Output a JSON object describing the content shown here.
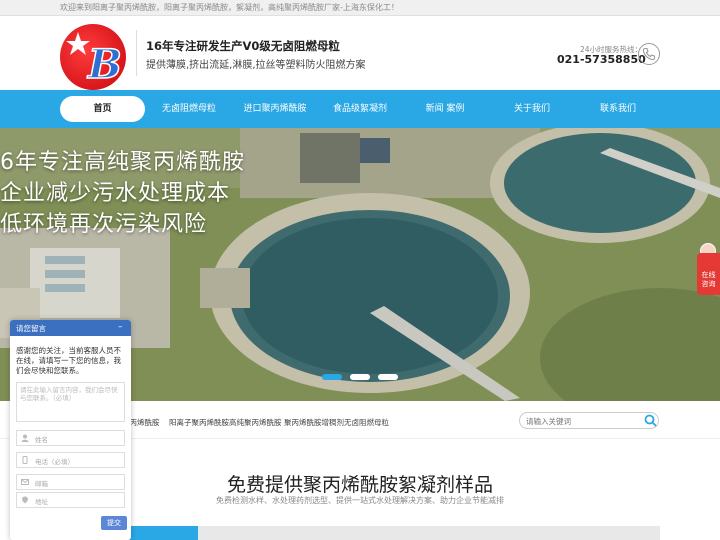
{
  "topbar": {
    "welcome": "欢迎来到阳离子聚丙烯酰胺，阳离子聚丙烯酰胺，絮凝剂，高纯聚丙烯酰胺厂家-上海东保化工！"
  },
  "header": {
    "slogan_main": "16年专注研发生产V0级无卤阻燃母粒",
    "slogan_sub": "提供薄膜,挤出流延,淋膜,拉丝等塑料防火阻燃方案",
    "hotline_label": "24小时服务热线：",
    "hotline": "021-57358850"
  },
  "nav": {
    "items": [
      {
        "label": "首页"
      },
      {
        "label": "无卤阻燃母粒"
      },
      {
        "label": "进口聚丙烯酰胺"
      },
      {
        "label": "食品级絮凝剂"
      },
      {
        "label": "新闻 案例"
      },
      {
        "label": "关于我们"
      },
      {
        "label": "联系我们"
      }
    ]
  },
  "banner": {
    "line1": "6年专注高纯聚丙烯酰胺",
    "line2": "企业减少污水处理成本",
    "line3": "低环境再次污染风险"
  },
  "float_tab": {
    "label": "在线咨询"
  },
  "keywords": {
    "items": [
      "聚丙烯酰胺",
      "阳离子聚丙烯酰胺",
      "高纯聚丙烯酰胺",
      "聚丙烯酰胺增稠剂",
      "无卤阻燃母粒"
    ],
    "search_placeholder": "请输入关键词"
  },
  "section": {
    "title": "免费提供聚丙烯酰胺絮凝剂样品",
    "subtitle": "免费检测水样、水处理药剂选型、提供一站式水处理解决方案、助力企业节能减排"
  },
  "chat": {
    "title": "请您留言",
    "message": "感谢您的关注，当前客服人员不在线，请填写一下您的信息，我们会尽快和您联系。",
    "textarea_placeholder": "请在此输入留言内容，我们会尽快与您联系。（必填）",
    "name_placeholder": "姓名",
    "phone_placeholder": "电话（必填）",
    "email_placeholder": "邮箱",
    "address_placeholder": "地址",
    "submit": "提交"
  },
  "colors": {
    "brand_blue": "#2aa7e5",
    "chat_blue": "#3b6fbf",
    "logo_red": "#d71b1b",
    "accent_red": "#e43935"
  }
}
